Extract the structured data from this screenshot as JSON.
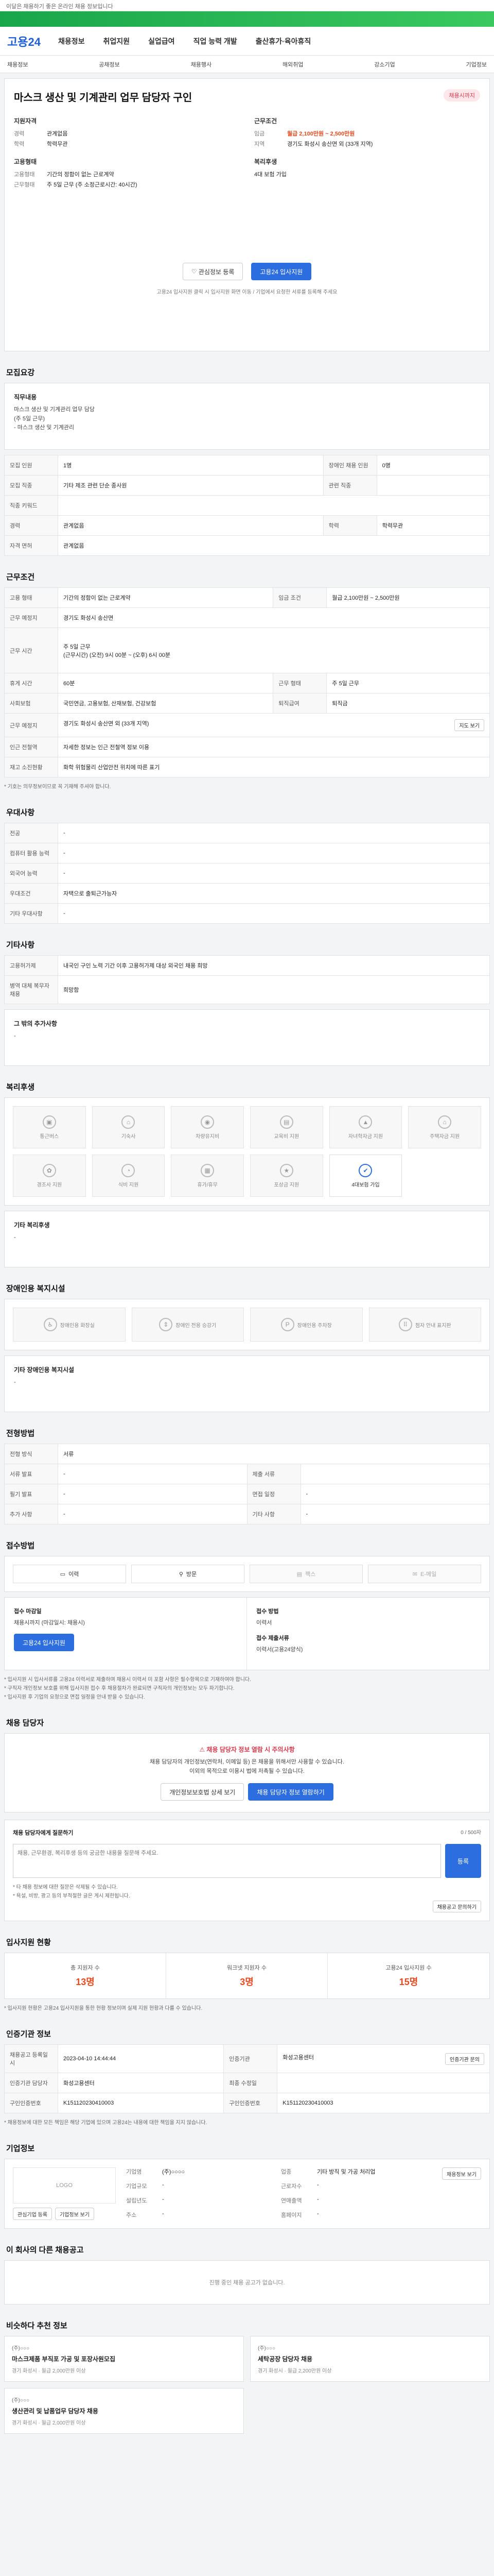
{
  "topbar": {
    "text": "이달은 채용하기 좋은 온라인 채용 정보입니다"
  },
  "adband": {
    "text": ""
  },
  "header": {
    "logo": "고용24",
    "gnb": [
      "채용정보",
      "취업지원",
      "실업급여",
      "직업 능력 개발",
      "출산휴가·육아휴직"
    ]
  },
  "subnav": [
    "채용정보",
    "공채정보",
    "채용행사",
    "해외취업",
    "강소기업",
    "기업정보"
  ],
  "job": {
    "title": "마스크 생산 및 기계관리 업무 담당자 구인",
    "badge": "채용시까지",
    "left_group1_title": "지원자격",
    "left_group1": [
      {
        "k": "경력",
        "v": "관계없음"
      },
      {
        "k": "학력",
        "v": "학력무관"
      }
    ],
    "right_group1_title": "근무조건",
    "right_group1": [
      {
        "k": "임금",
        "v": "월급 2,100만원 ~ 2,500만원"
      },
      {
        "k": "지역",
        "v": "경기도 화성시 송산면 외 (33개 지역)"
      }
    ],
    "left_group2_title": "고용형태",
    "left_group2": [
      {
        "k": "고용형태",
        "v": "기간의 정함이 없는 근로계약"
      },
      {
        "k": "근무형태",
        "v": "주 5일 근무 (주 소정근로시간: 40시간)"
      }
    ],
    "right_group2_title": "복리후생",
    "right_group2": [
      {
        "k": "",
        "v": "4대 보험 가입"
      }
    ],
    "btn_save": "관심정보 등록",
    "btn_apply": "고용24 입사지원",
    "note": "고용24 입사지원 클릭 시 입사지원 화면 이동 / 기업에서 요청한 서류를 등록해 주세요"
  },
  "sections": {
    "recruit": "모집요강",
    "conditions": "근무조건",
    "emp_type": "우대사항",
    "other": "기타사항",
    "welfare": "복리후생",
    "disabled": "장애인용 복지시설",
    "apply_method": "전형방법",
    "receive": "접수방법",
    "contact": "채용 담당자",
    "qa": "채용 담당자에게 질문하기",
    "stats": "입사지원 현황",
    "info": "인증기관 정보",
    "company": "기업정보",
    "other_jobs": "이 회사의 다른 채용공고",
    "recommend": "비슷하다 추천 정보"
  },
  "recruit": {
    "duty_title": "직무내용",
    "duty_text": "마스크 생산 및 기계관리 업무 담당\n(주 5일 근무)\n- 마스크 생산 및 기계관리",
    "rows": [
      {
        "h": "모집 인원",
        "v": "1명",
        "h2": "장애인 채용 인원",
        "v2": "0명"
      },
      {
        "h": "모집 직종",
        "v": "기타 제조 관련 단순 종사원",
        "h2": "관련 직종",
        "v2": ""
      },
      {
        "h": "직종 키워드",
        "v": "",
        "h2": "",
        "v2": ""
      },
      {
        "h": "경력",
        "v": "관계없음",
        "h2": "학력",
        "v2": "학력무관"
      },
      {
        "h": "자격 면허",
        "v": "관계없음",
        "h2": "",
        "v2": ""
      }
    ]
  },
  "conditions": {
    "rows": [
      {
        "h": "고용 형태",
        "v": "기간의 정함이 없는 근로계약",
        "h2": "임금 조건",
        "v2": "월급 2,100만원 ~ 2,500만원"
      },
      {
        "h": "근무 예정지",
        "v": "경기도 화성시 송산면",
        "h2": "",
        "v2": ""
      },
      {
        "h": "근무 시간",
        "v": "주 5일 근무\n(근무시간) (오전) 9시 00분 ~ (오후) 6시 00분",
        "h2": "",
        "v2": ""
      },
      {
        "h": "휴게 시간",
        "v": "60분",
        "h2": "근무 형태",
        "v2": "주 5일 근무"
      },
      {
        "h": "사회보험",
        "v": "국민연금, 고용보험, 산재보험, 건강보험",
        "h2": "퇴직급여",
        "v2": "퇴직금"
      },
      {
        "h": "근무 예정지",
        "v": "경기도 화성시 송산면 외 (33개 지역)",
        "h2": "",
        "v2": ""
      },
      {
        "h": "인근 전철역",
        "v": "자세한 정보는 인근 전철역 정보 이용",
        "h2": "",
        "v2": ""
      },
      {
        "h": "재고 소진현황",
        "v": "화학 위험물리 산업안전 위치에 따른 표기",
        "h2": "",
        "v2": ""
      }
    ],
    "map_btn": "지도 보기",
    "note": "* 기호는 의무정보이므로 꼭 기재해 주셔야 합니다."
  },
  "prefer": {
    "rows": [
      {
        "h": "전공",
        "v": "-"
      },
      {
        "h": "컴퓨터 활용 능력",
        "v": "-"
      },
      {
        "h": "외국어 능력",
        "v": "-"
      },
      {
        "h": "우대조건",
        "v": "자택으로 출퇴근가능자"
      },
      {
        "h": "기타 우대사항",
        "v": "-"
      }
    ]
  },
  "other": {
    "rows": [
      {
        "h": "고용허가제",
        "v": "내국인 구인 노력 기간 이후 고용허가제 대상 외국인 채용 희망"
      },
      {
        "h": "병역 대체 복무자 채용",
        "v": "희망함"
      }
    ],
    "other_title": "그 밖의 추가사항",
    "other_text": "-"
  },
  "welfare": {
    "items": [
      {
        "label": "통근버스",
        "active": false
      },
      {
        "label": "기숙사",
        "active": false
      },
      {
        "label": "차량유지비",
        "active": false
      },
      {
        "label": "교육비 지원",
        "active": false
      },
      {
        "label": "자녀학자금 지원",
        "active": false
      },
      {
        "label": "주택자금 지원",
        "active": false
      },
      {
        "label": "경조사 지원",
        "active": false
      },
      {
        "label": "식비 지원",
        "active": false
      },
      {
        "label": "휴가/휴무",
        "active": false
      },
      {
        "label": "포상금 지원",
        "active": false
      },
      {
        "label": "4대보험 가입",
        "active": true
      }
    ],
    "other_title": "기타 복리후생",
    "other_text": "-"
  },
  "disabled": {
    "items": [
      "장애인용 화장실",
      "장애인 전용 승강기",
      "장애인용 주차장",
      "점자 안내 표지판"
    ],
    "other_title": "기타 장애인용 복지시설",
    "other_text": "-"
  },
  "apply": {
    "rows": [
      {
        "h": "전형 방식",
        "v": "서류",
        "h2": "",
        "v2": ""
      },
      {
        "h": "서류 발표",
        "v": "-",
        "h2": "제출 서류",
        "v2": ""
      },
      {
        "h": "필기 발표",
        "v": "-",
        "h2": "면접 일정",
        "v2": "-"
      },
      {
        "h": "추가 사항",
        "v": "-",
        "h2": "기타 사항",
        "v2": "-"
      }
    ]
  },
  "receive": {
    "tabs": [
      {
        "label": "이력",
        "off": false
      },
      {
        "label": "방문",
        "off": false
      },
      {
        "label": "팩스",
        "off": true
      },
      {
        "label": "E-메일",
        "off": true
      }
    ],
    "left_k": "접수 마감일",
    "left_v": "채용시까지 (마감일시: 채용시)",
    "left_btn": "고용24 입사지원",
    "right_k1": "접수 방법",
    "right_v1": "이력서",
    "right_k2": "접수 제출서류",
    "right_v2": "이력서(고용24양식)",
    "bullets": "* 입사지원 시 입사서류를 고용24 이력서로 제출하며 채용시 이력서 미 포함 사항은 필수항목으로 기재하여야 합니다.\n* 구직자 개인정보 보호를 위해 입사지원 접수 후 채용절차가 완료되면 구직자의 개인정보는 모두 파기합니다.\n* 입사지원 후 기업의 요청으로 면접 일정을 안내 받을 수 있습니다."
  },
  "contact": {
    "head": "채용 담당자 정보 열람 시 주의사항",
    "text": "채용 담당자의 개인정보(연락처, 이메일 등) 은 채용을 위해서만 사용할 수 있습니다.\n이외의 목적으로 이용시 법에 저촉될 수 있습니다.",
    "btn1": "개인정보보호법 상세 보기",
    "btn2": "채용 담당자 정보 열람하기"
  },
  "qa": {
    "title": "채용 담당자에게 질문하기",
    "placeholder": "채용, 근무환경, 복리후생 등의 궁금한 내용을 질문해 주세요.",
    "btn": "등록",
    "count": "0 / 500자",
    "notes": "* 타 채용 정보에 대한 질문은 삭제될 수 있습니다.\n* 욕설, 비방, 광고 등의 부적절한 글은 게시 제한됩니다.",
    "link": "채용공고 문의하기"
  },
  "stats": {
    "items": [
      {
        "lbl": "총 지원자 수",
        "num": "13명"
      },
      {
        "lbl": "워크넷 지원자 수",
        "num": "3명"
      },
      {
        "lbl": "고용24 입사지원 수",
        "num": "15명"
      }
    ],
    "note": "* 입사지원 현황은 고용24 입사지원을 통한 현황 정보이며 실제 지원 현황과 다를 수 있습니다."
  },
  "info": {
    "rows": [
      {
        "h": "채용공고 등록일시",
        "v": "2023-04-10 14:44:44",
        "h2": "인증기관",
        "v2": "화성고용센터"
      },
      {
        "h": "인증기관 담당자",
        "v": "화성고용센터",
        "h2": "최종 수정일",
        "v2": ""
      },
      {
        "h": "구인인증번호",
        "v": "K151120230410003",
        "h2": "구인인증번호",
        "v2": "K151120230410003"
      }
    ],
    "btn": "인증기관 문의",
    "note": "* 채용정보에 대한 모든 책임은 해당 기업에 있으며 고용24는 내용에 대한 책임을 지지 않습니다."
  },
  "company": {
    "logo": "LOGO",
    "name": "기업명",
    "fields": [
      {
        "k": "기업명",
        "v": "(주)○○○○"
      },
      {
        "k": "업종",
        "v": "기타 방직 및 가공 처리업"
      },
      {
        "k": "기업규모",
        "v": "-"
      },
      {
        "k": "근로자수",
        "v": "-"
      },
      {
        "k": "설립년도",
        "v": "-"
      },
      {
        "k": "연매출액",
        "v": "-"
      },
      {
        "k": "주소",
        "v": "-"
      },
      {
        "k": "홈페이지",
        "v": "-"
      }
    ],
    "btn1": "관심기업 등록",
    "btn2": "기업정보 보기",
    "btn3": "채용정보 보기"
  },
  "other_jobs": {
    "empty": "진행 중인 채용 공고가 없습니다."
  },
  "recommend": {
    "items": [
      {
        "co": "(주)○○○",
        "title": "마스크제품 부직포 가공 및 포장사원모집",
        "meta": "경기 화성시 · 월급 2,000만원 이상"
      },
      {
        "co": "(주)○○○",
        "title": "세탁공장 담당자 채용",
        "meta": "경기 화성시 · 월급 2,200만원 이상"
      },
      {
        "co": "(주)○○○",
        "title": "생산관리 및 납품업무 담당자 채용",
        "meta": "경기 화성시 · 월급 2,000만원 이상"
      }
    ]
  }
}
